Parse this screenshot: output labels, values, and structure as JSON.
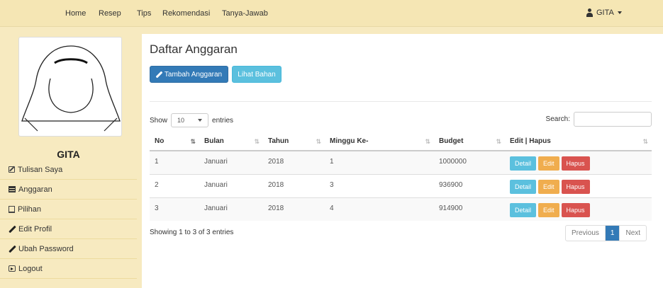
{
  "nav": {
    "items": [
      "Home",
      "Resep",
      "Tips",
      "Rekomendasi",
      "Tanya-Jawab"
    ],
    "user": "GITA"
  },
  "sidebar": {
    "name": "GITA",
    "items": [
      {
        "label": "Tulisan Saya",
        "icon": "edit-icon"
      },
      {
        "label": "Anggaran",
        "icon": "list-icon"
      },
      {
        "label": "Pilihan",
        "icon": "bookmark-icon"
      },
      {
        "label": "Edit Profil",
        "icon": "pencil-icon"
      },
      {
        "label": "Ubah Password",
        "icon": "pencil-icon"
      },
      {
        "label": "Logout",
        "icon": "logout-icon"
      }
    ]
  },
  "main": {
    "title": "Daftar Anggaran",
    "add_button": "Tambah Anggaran",
    "view_button": "Lihat Bahan",
    "show_label": "Show",
    "entries_label": "entries",
    "length_value": "10",
    "search_label": "Search:",
    "search_value": ""
  },
  "table": {
    "headers": [
      "No",
      "Bulan",
      "Tahun",
      "Minggu Ke-",
      "Budget",
      "Edit | Hapus"
    ],
    "rows": [
      {
        "no": "1",
        "bulan": "Januari",
        "tahun": "2018",
        "minggu": "1",
        "budget": "1000000"
      },
      {
        "no": "2",
        "bulan": "Januari",
        "tahun": "2018",
        "minggu": "3",
        "budget": "936900"
      },
      {
        "no": "3",
        "bulan": "Januari",
        "tahun": "2018",
        "minggu": "4",
        "budget": "914900"
      }
    ],
    "action_labels": {
      "detail": "Detail",
      "edit": "Edit",
      "hapus": "Hapus"
    }
  },
  "footer": {
    "info": "Showing 1 to 3 of 3 entries",
    "previous": "Previous",
    "page": "1",
    "next": "Next"
  },
  "colors": {
    "navbar": "#f5e6b4",
    "sidebar": "#f7eac0",
    "primary": "#337ab7",
    "info": "#5bc0de",
    "warning": "#f0ad4e",
    "danger": "#d9534f"
  }
}
